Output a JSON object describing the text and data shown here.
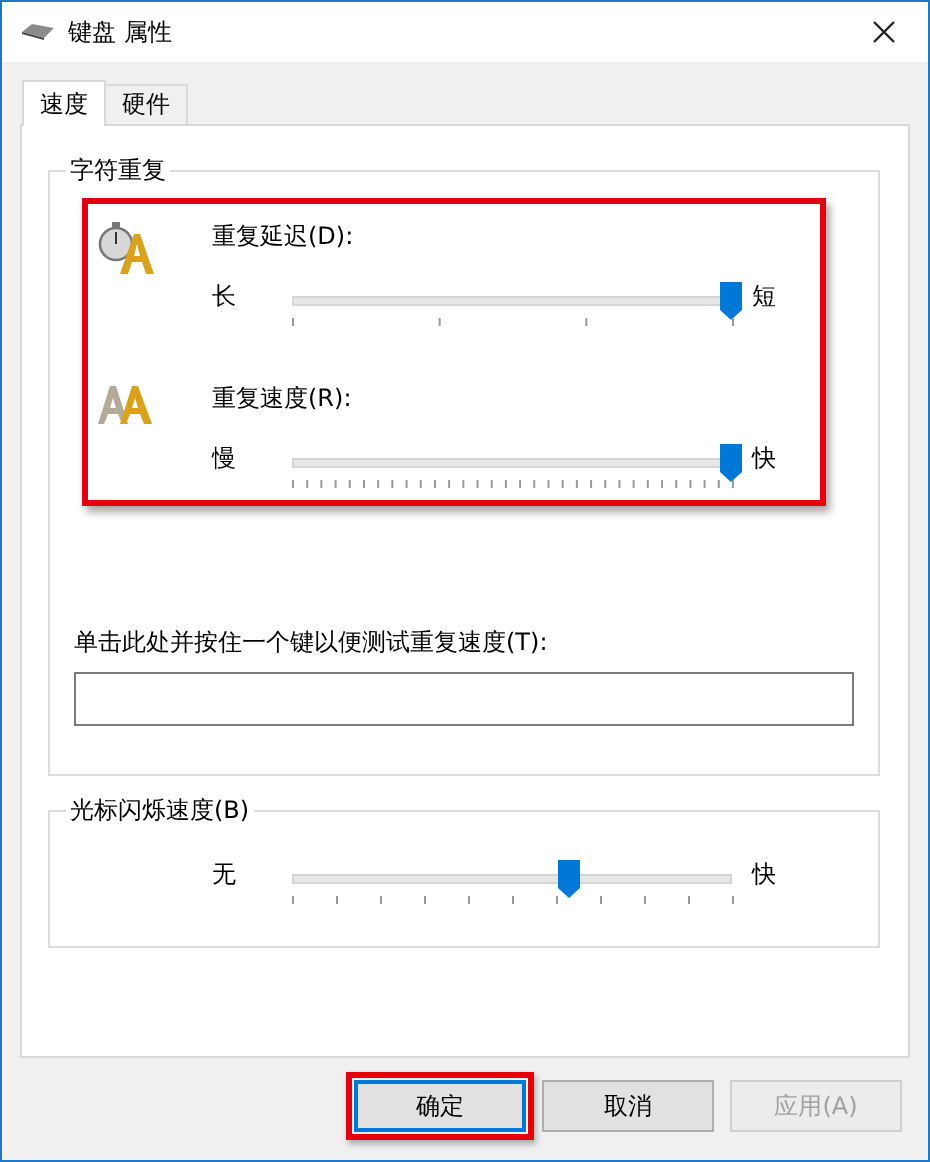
{
  "window": {
    "title": "键盘 属性"
  },
  "tabs": [
    {
      "label": "速度",
      "selected": true
    },
    {
      "label": "硬件",
      "selected": false
    }
  ],
  "groups": [
    {
      "title": "字符重复",
      "highlighted": true,
      "sliders": [
        {
          "kind": "delay",
          "label": "重复延迟(D):",
          "min_label": "长",
          "max_label": "短",
          "level": 1
        },
        {
          "kind": "rate",
          "label": "重复速度(R):",
          "min_label": "慢",
          "max_label": "快",
          "level": 1
        }
      ],
      "test_field": {
        "label": "单击此处并按住一个键以便测试重复速度(T):"
      }
    },
    {
      "title": "光标闪烁速度(B)",
      "highlighted": false,
      "sliders": [
        {
          "kind": "blink",
          "min_label": "无",
          "max_label": "快",
          "level": 0.63
        }
      ]
    }
  ],
  "buttons": [
    {
      "label": "确定",
      "default": true,
      "highlighted": true,
      "disabled": false
    },
    {
      "label": "取消",
      "default": false,
      "highlighted": false,
      "disabled": false
    },
    {
      "label": "应用(A)",
      "default": false,
      "highlighted": false,
      "disabled": true
    }
  ]
}
